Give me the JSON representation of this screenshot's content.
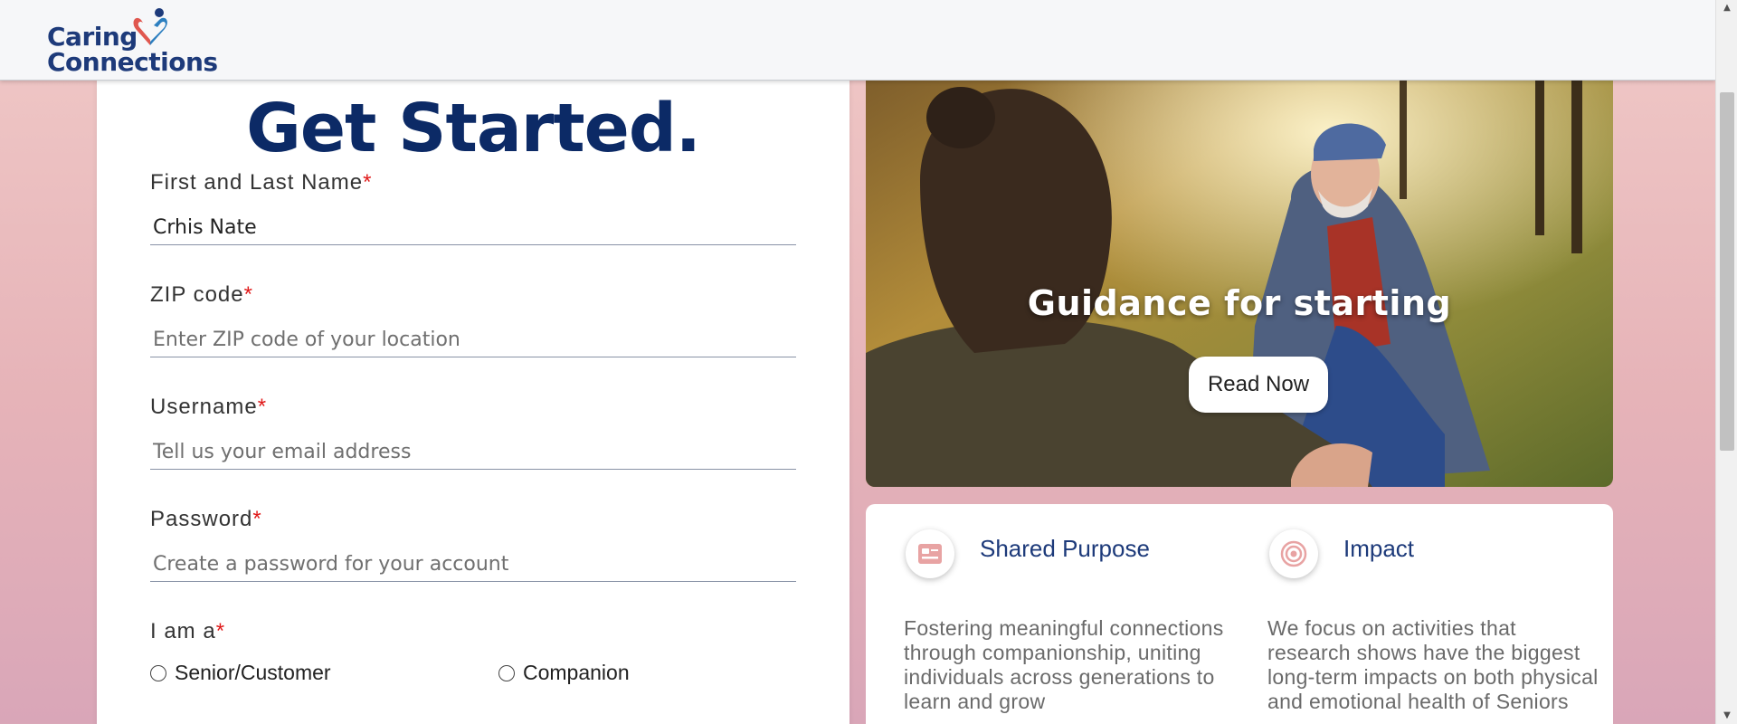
{
  "header": {
    "logo_line1": "Caring",
    "logo_line2": "Connections"
  },
  "form": {
    "title": "Get Started.",
    "required_mark": "*",
    "fields": [
      {
        "label": "First and Last Name",
        "value": "Crhis Nate",
        "placeholder": ""
      },
      {
        "label": "ZIP code",
        "value": "",
        "placeholder": "Enter ZIP code of your location"
      },
      {
        "label": "Username",
        "value": "",
        "placeholder": "Tell us your email address"
      },
      {
        "label": "Password",
        "value": "",
        "placeholder": "Create a password for your account"
      }
    ],
    "role_label": "I am a",
    "role_options": [
      "Senior/Customer",
      "Companion"
    ]
  },
  "hero": {
    "title": "Guidance for starting",
    "button_label": "Read Now"
  },
  "info": [
    {
      "title": "Shared Purpose",
      "icon": "id-card-icon",
      "text": "Fostering meaningful connections through companionship, uniting individuals across generations to learn and grow"
    },
    {
      "title": "Impact",
      "icon": "target-icon",
      "text": "We focus on activities that research shows have the biggest long-term impacts on both physical and emotional health of Seniors"
    }
  ],
  "colors": {
    "brand_navy": "#0c2a66",
    "required_red": "#e01919",
    "icon_pink": "#e8a3a3"
  }
}
